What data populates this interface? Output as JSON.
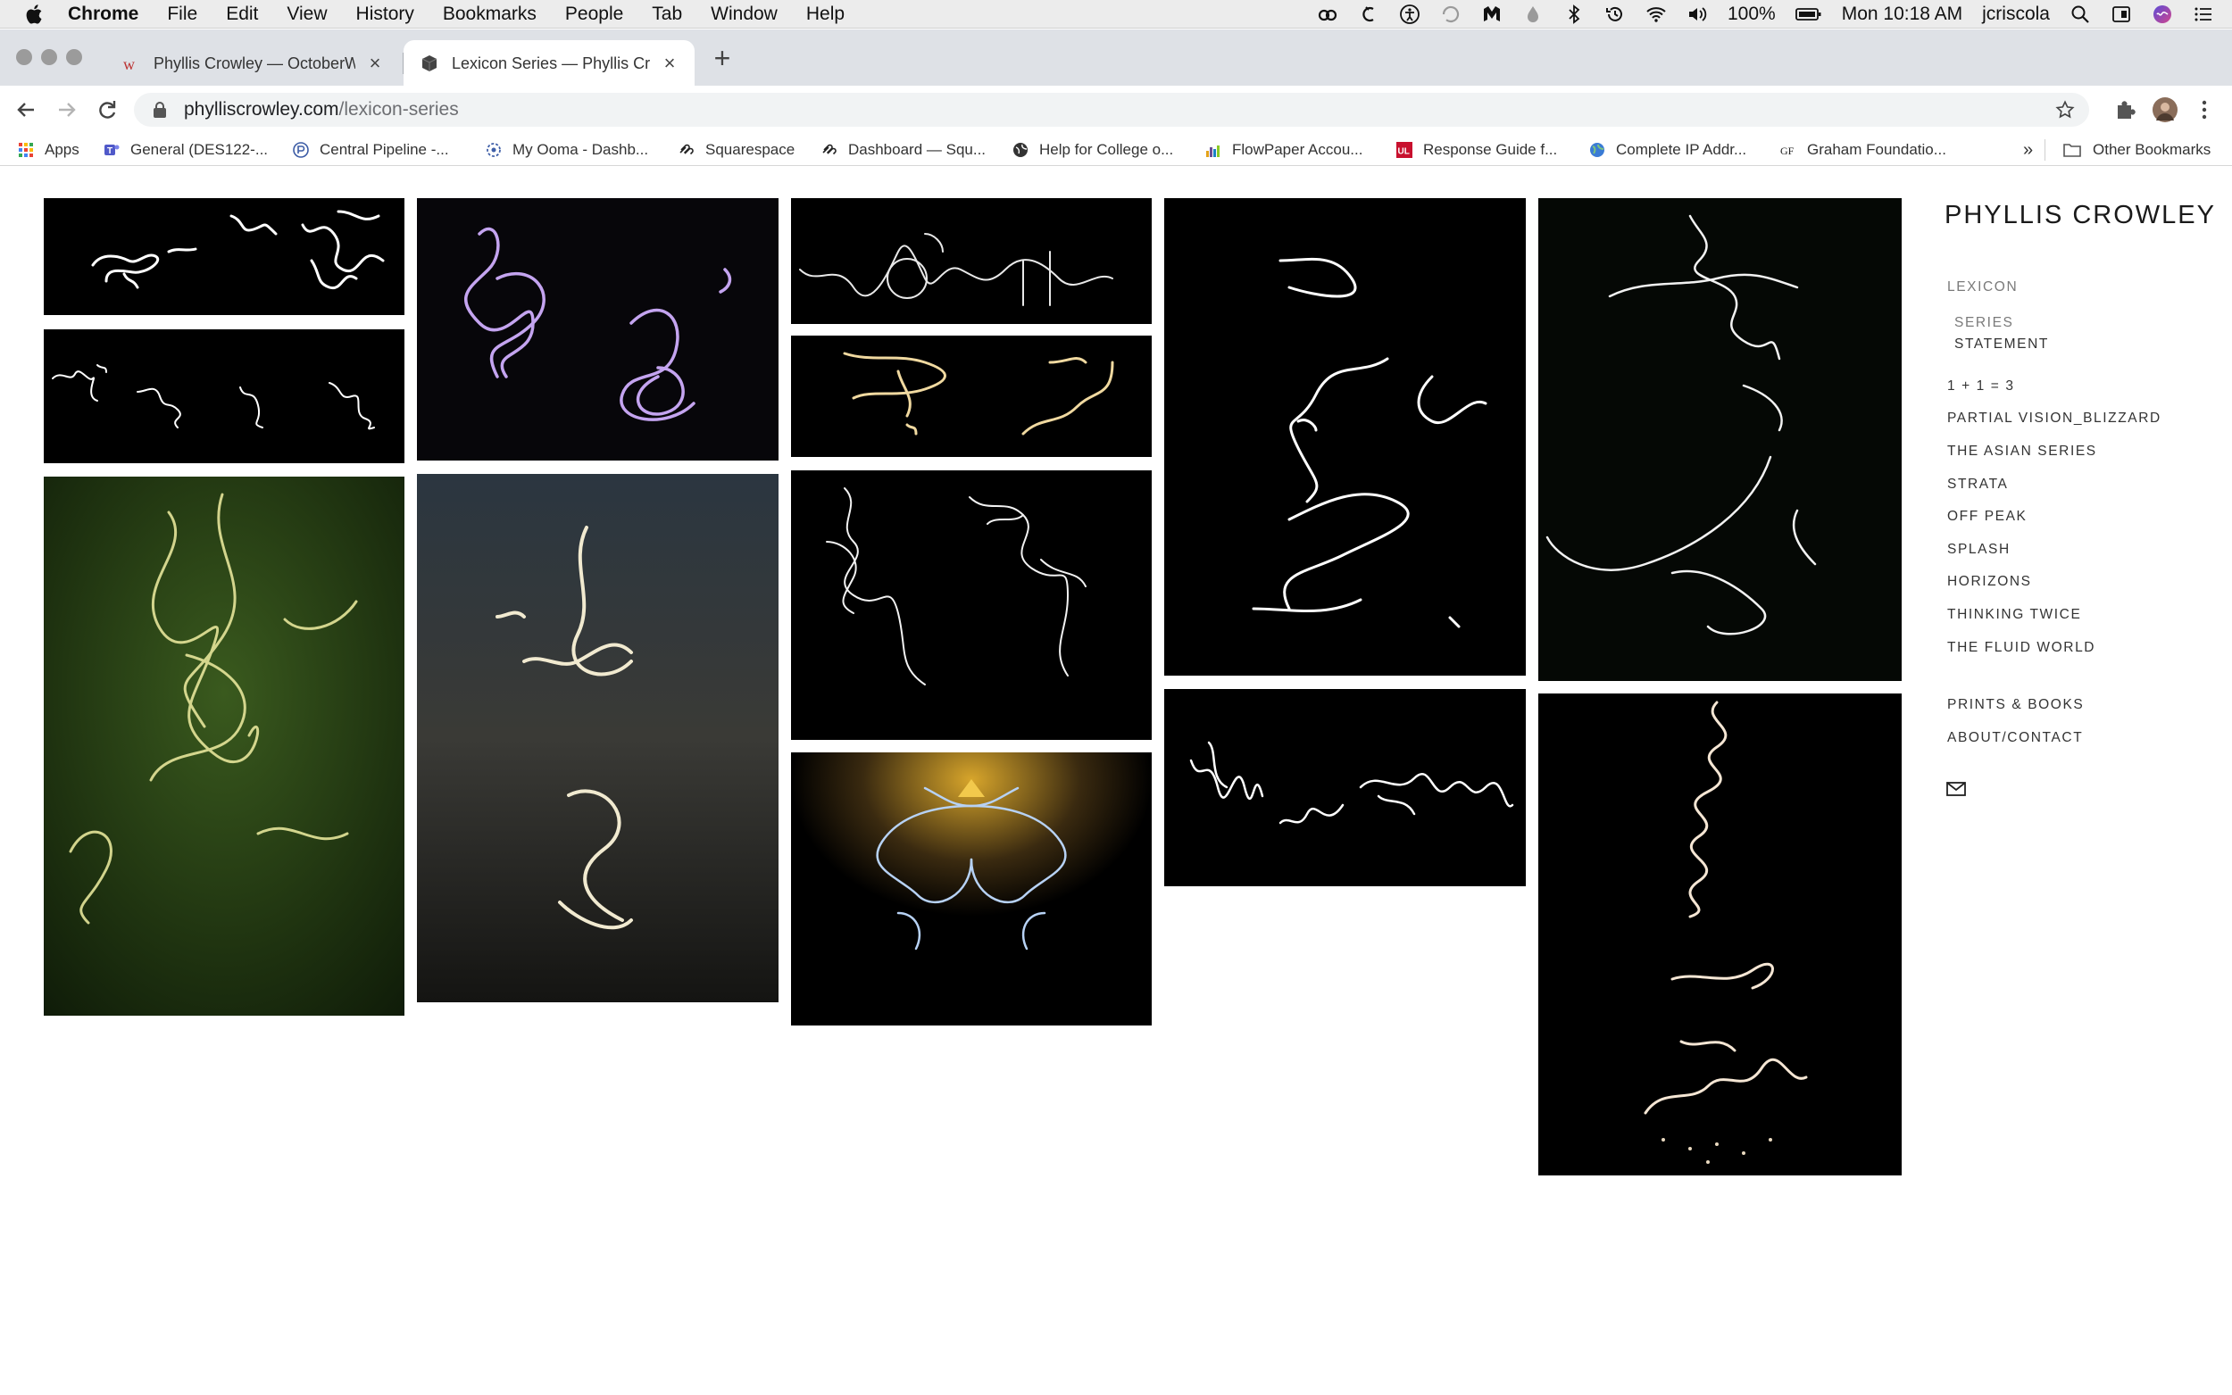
{
  "menubar": {
    "app": "Chrome",
    "items": [
      "File",
      "Edit",
      "View",
      "History",
      "Bookmarks",
      "People",
      "Tab",
      "Window",
      "Help"
    ],
    "battery": "100%",
    "clock": "Mon 10:18 AM",
    "user": "jcriscola",
    "icons": [
      "creative-cloud-icon",
      "cache-icon",
      "accessibility-icon",
      "sync-icon",
      "malwarebytes-icon",
      "drop-icon",
      "bluetooth-icon",
      "time-machine-icon",
      "wifi-icon",
      "volume-icon",
      "battery-icon",
      "search-icon",
      "display-icon",
      "siri-icon",
      "notification-center-icon"
    ]
  },
  "tabs": [
    {
      "title": "Phyllis Crowley — OctoberWor",
      "favicon": "w-logo-icon",
      "active": false
    },
    {
      "title": "Lexicon Series — Phyllis Crowl",
      "favicon": "cube-icon",
      "active": true
    }
  ],
  "address": {
    "domain": "phylliscrowley.com",
    "path": "/lexicon-series"
  },
  "bookmarks": [
    {
      "label": "Apps",
      "icon": "apps-grid-icon"
    },
    {
      "label": "General (DES122-...",
      "icon": "teams-icon"
    },
    {
      "label": "Central Pipeline -...",
      "icon": "pipeline-icon"
    },
    {
      "label": "My Ooma - Dashb...",
      "icon": "ooma-icon"
    },
    {
      "label": "Squarespace",
      "icon": "squarespace-icon"
    },
    {
      "label": "Dashboard — Squ...",
      "icon": "squarespace-icon"
    },
    {
      "label": "Help for College o...",
      "icon": "globe-icon"
    },
    {
      "label": "FlowPaper Accou...",
      "icon": "flowpaper-icon"
    },
    {
      "label": "Response Guide f...",
      "icon": "ul-icon"
    },
    {
      "label": "Complete IP Addr...",
      "icon": "globe-icon"
    },
    {
      "label": "Graham Foundatio...",
      "icon": "gf-icon"
    }
  ],
  "bookmarks_overflow": "»",
  "other_bookmarks": "Other Bookmarks",
  "site": {
    "title": "PHYLLIS CROWLEY",
    "nav": {
      "lexicon": "LEXICON",
      "series": "SERIES",
      "statement": "STATEMENT",
      "items": [
        "1 + 1 = 3",
        "PARTIAL VISION_BLIZZARD",
        "THE ASIAN SERIES",
        "STRATA",
        "OFF PEAK",
        "SPLASH",
        "HORIZONS",
        "THINKING TWICE",
        "THE FLUID WORLD"
      ],
      "prints": "PRINTS & BOOKS",
      "about": "ABOUT/CONTACT"
    }
  }
}
